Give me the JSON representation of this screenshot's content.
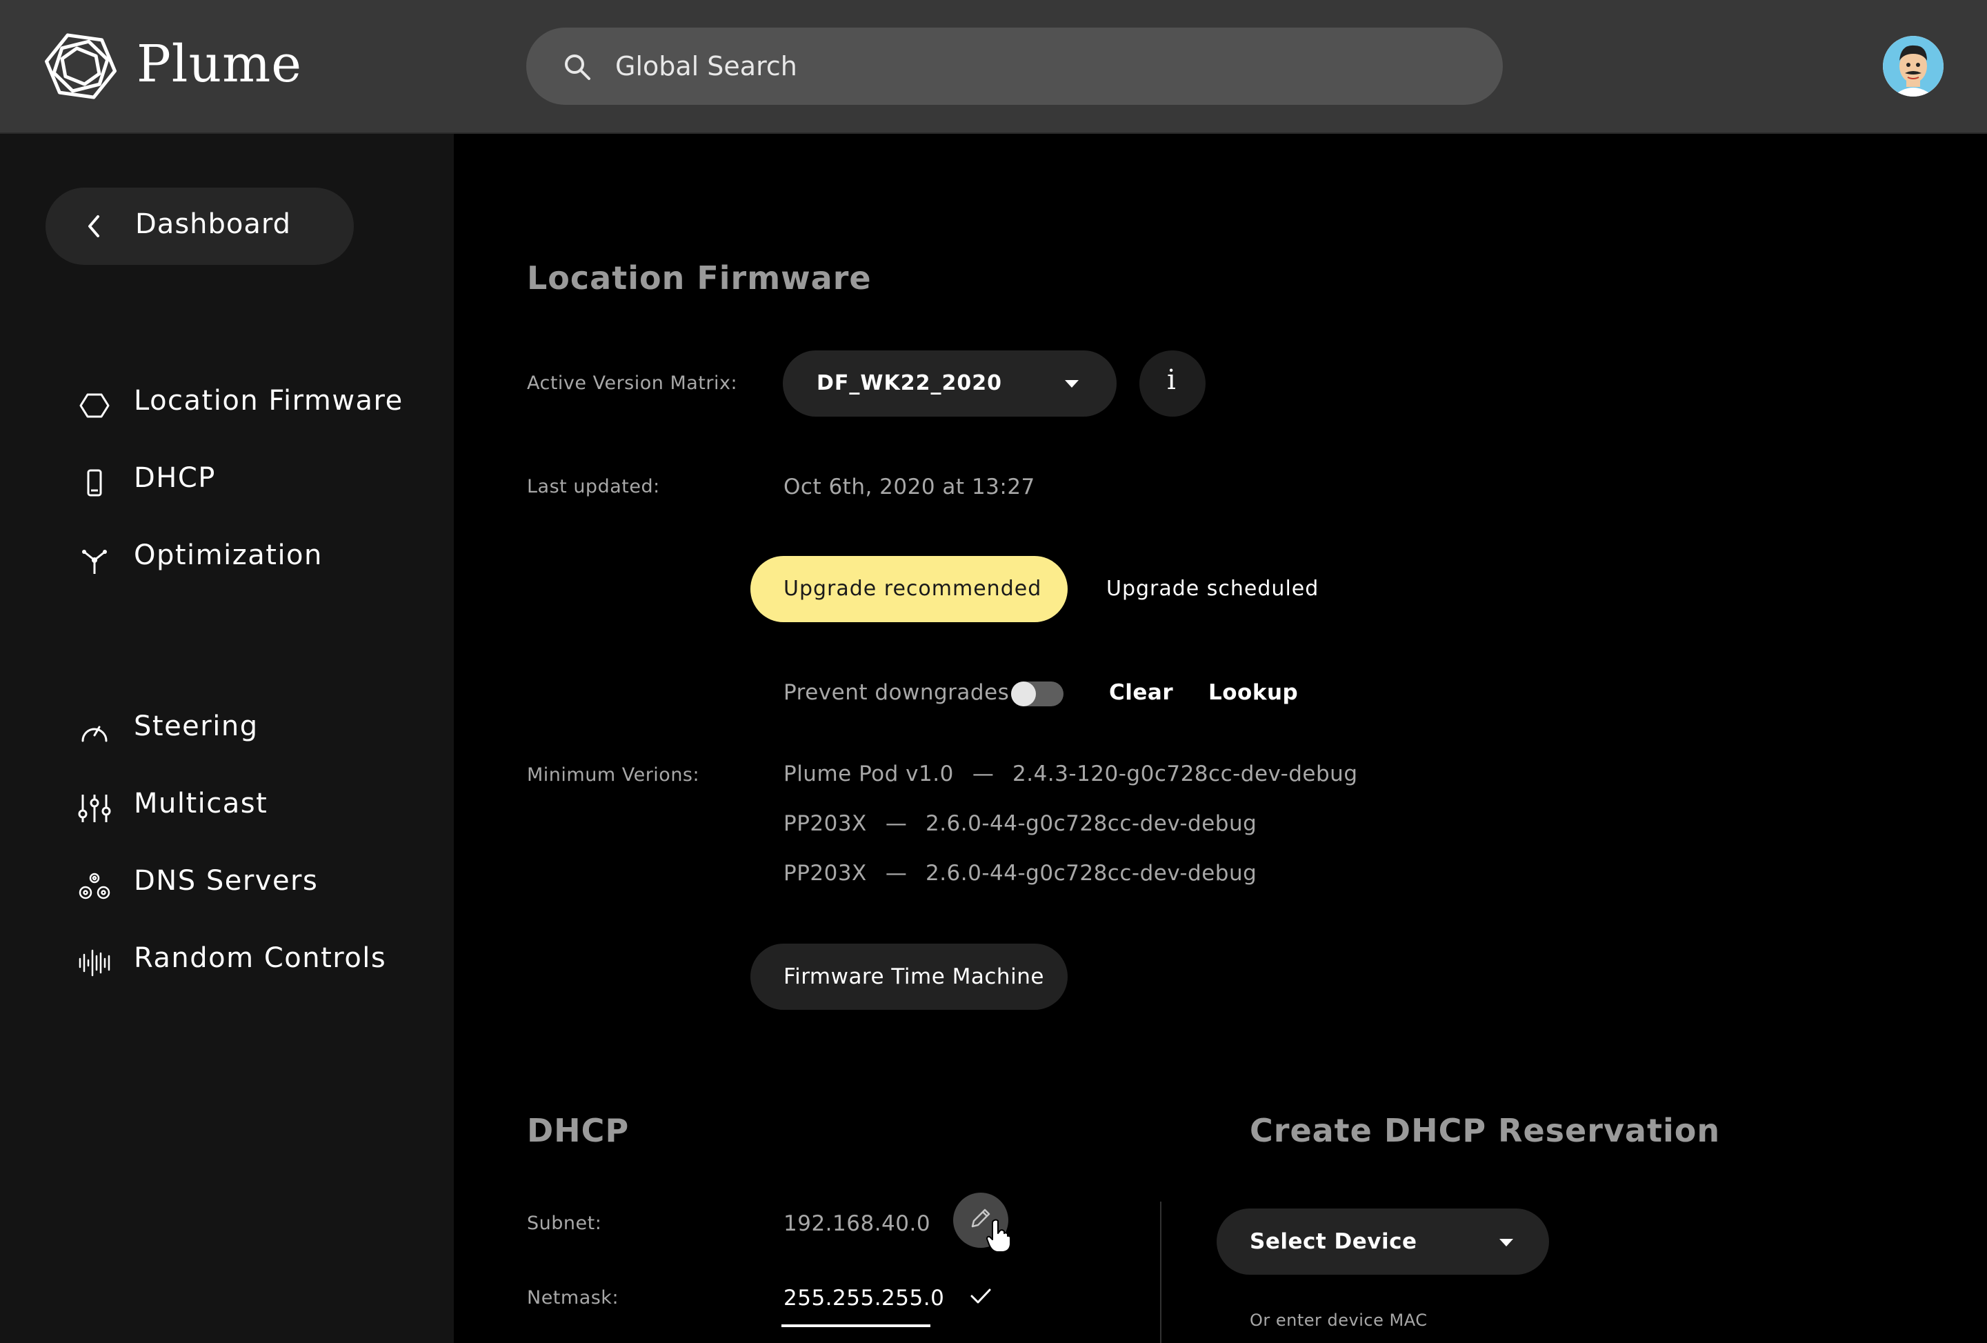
{
  "header": {
    "brand": "Plume",
    "search_placeholder": "Global Search",
    "icons": {
      "logo": "plume-logo",
      "search": "search-icon",
      "avatar": "user-avatar"
    }
  },
  "sidebar": {
    "back_label": "Dashboard",
    "group1": [
      {
        "label": "Location Firmware",
        "icon": "hexagon-icon"
      },
      {
        "label": "DHCP",
        "icon": "device-icon"
      },
      {
        "label": "Optimization",
        "icon": "network-fork-icon"
      }
    ],
    "group2": [
      {
        "label": "Steering",
        "icon": "speedometer-icon"
      },
      {
        "label": "Multicast",
        "icon": "sliders-icon"
      },
      {
        "label": "DNS Servers",
        "icon": "gears-icon"
      },
      {
        "label": "Random Controls",
        "icon": "waveform-icon"
      }
    ]
  },
  "firmware": {
    "title": "Location Firmware",
    "active_matrix_label": "Active Version Matrix:",
    "active_matrix_value": "DF_WK22_2020",
    "info_glyph": "i",
    "last_updated_label": "Last updated:",
    "last_updated_value": "Oct 6th, 2020 at 13:27",
    "upgrade_recommended": "Upgrade recommended",
    "upgrade_scheduled": "Upgrade scheduled",
    "prevent_downgrades_label": "Prevent downgrades",
    "prevent_downgrades_on": false,
    "clear_label": "Clear",
    "lookup_label": "Lookup",
    "min_versions_label": "Minimum Verions:",
    "min_versions": [
      {
        "model": "Plume Pod v1.0",
        "version": "2.4.3-120-g0c728cc-dev-debug"
      },
      {
        "model": "PP203X",
        "version": "2.6.0-44-g0c728cc-dev-debug"
      },
      {
        "model": "PP203X",
        "version": "2.6.0-44-g0c728cc-dev-debug"
      }
    ],
    "separator": "—",
    "time_machine_label": "Firmware Time Machine"
  },
  "dhcp": {
    "title": "DHCP",
    "subnet_label": "Subnet:",
    "subnet_value": "192.168.40.0",
    "netmask_label": "Netmask:",
    "netmask_value": "255.255.255.0"
  },
  "reservation": {
    "title": "Create DHCP Reservation",
    "select_device_label": "Select Device",
    "mac_hint": "Or enter device MAC"
  },
  "colors": {
    "topbar": "#383838",
    "sidebar": "#141414",
    "accent_yellow": "#fcec8c",
    "muted_text": "#a8a8a8"
  }
}
